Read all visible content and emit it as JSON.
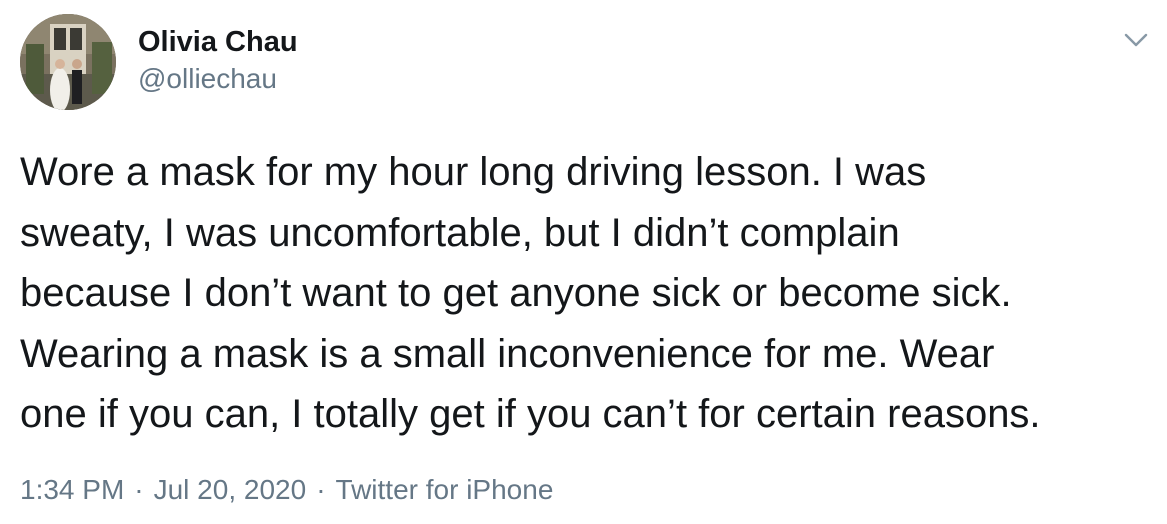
{
  "user": {
    "display_name": "Olivia Chau",
    "handle": "@olliechau",
    "avatar_icon": "wedding-photo-avatar"
  },
  "tweet": {
    "lines": [
      "Wore a mask for my hour long driving lesson. I was",
      "sweaty, I was uncomfortable, but I didn’t complain",
      "because I don’t want to get anyone sick or become sick.",
      "Wearing a mask is a small inconvenience for me. Wear",
      "one if you can, I totally get if you can’t for certain reasons."
    ]
  },
  "meta": {
    "time": "1:34 PM",
    "separator": "·",
    "date": "Jul 20, 2020",
    "source": "Twitter for iPhone"
  },
  "icons": {
    "menu": "chevron-down-icon"
  },
  "colors": {
    "text": "#14171a",
    "secondary": "#657786",
    "background": "#ffffff"
  }
}
